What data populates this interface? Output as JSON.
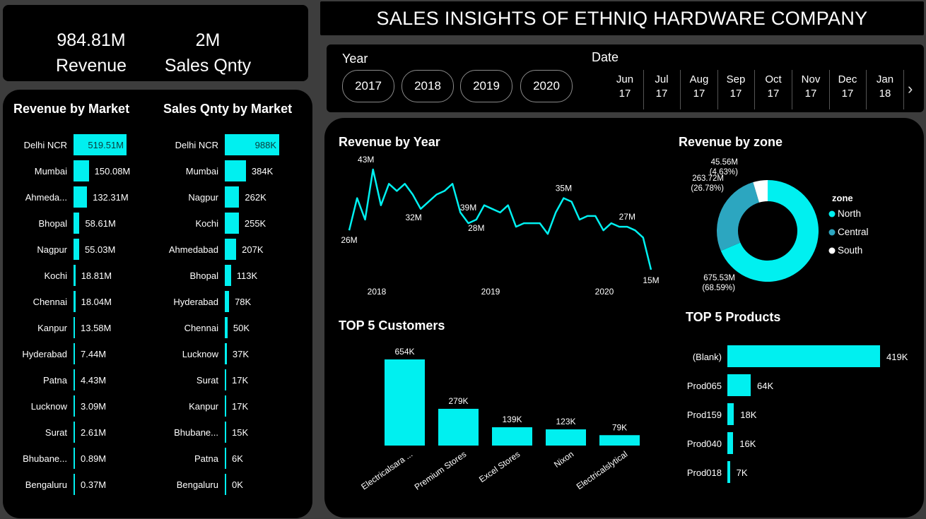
{
  "kpis": {
    "revenue_value": "984.81M",
    "revenue_label": "Revenue",
    "qty_value": "2M",
    "qty_label": "Sales Qnty"
  },
  "title": "SALES INSIGHTS OF ETHNIQ HARDWARE  COMPANY",
  "filters": {
    "year_label": "Year",
    "years": [
      "2017",
      "2018",
      "2019",
      "2020"
    ],
    "date_label": "Date",
    "dates": [
      {
        "m": "Jun",
        "y": "17"
      },
      {
        "m": "Jul",
        "y": "17"
      },
      {
        "m": "Aug",
        "y": "17"
      },
      {
        "m": "Sep",
        "y": "17"
      },
      {
        "m": "Oct",
        "y": "17"
      },
      {
        "m": "Nov",
        "y": "17"
      },
      {
        "m": "Dec",
        "y": "17"
      },
      {
        "m": "Jan",
        "y": "18"
      }
    ],
    "next_icon": "chevron-right-icon"
  },
  "colors": {
    "accent": "#00f0f0",
    "central": "#2ca6c0",
    "south": "#ffffff",
    "panel": "#000000",
    "background": "#3d3d3d"
  },
  "chart_data": [
    {
      "type": "bar",
      "orientation": "horizontal",
      "title": "Revenue by Market",
      "categories": [
        "Delhi NCR",
        "Mumbai",
        "Ahmeda...",
        "Bhopal",
        "Nagpur",
        "Kochi",
        "Chennai",
        "Kanpur",
        "Hyderabad",
        "Patna",
        "Lucknow",
        "Surat",
        "Bhubane...",
        "Bengaluru"
      ],
      "values": [
        519.51,
        150.08,
        132.31,
        58.61,
        55.03,
        18.81,
        18.04,
        13.58,
        7.44,
        4.43,
        3.09,
        2.61,
        0.89,
        0.37
      ],
      "labels": [
        "519.51M",
        "150.08M",
        "132.31M",
        "58.61M",
        "55.03M",
        "18.81M",
        "18.04M",
        "13.58M",
        "7.44M",
        "4.43M",
        "3.09M",
        "2.61M",
        "0.89M",
        "0.37M"
      ]
    },
    {
      "type": "bar",
      "orientation": "horizontal",
      "title": "Sales Qnty by Market",
      "categories": [
        "Delhi NCR",
        "Mumbai",
        "Nagpur",
        "Kochi",
        "Ahmedabad",
        "Bhopal",
        "Hyderabad",
        "Chennai",
        "Lucknow",
        "Surat",
        "Kanpur",
        "Bhubane...",
        "Patna",
        "Bengaluru"
      ],
      "values": [
        988,
        384,
        262,
        255,
        207,
        113,
        78,
        50,
        37,
        17,
        17,
        15,
        6,
        0
      ],
      "labels": [
        "988K",
        "384K",
        "262K",
        "255K",
        "207K",
        "113K",
        "78K",
        "50K",
        "37K",
        "17K",
        "17K",
        "15K",
        "6K",
        "0K"
      ]
    },
    {
      "type": "line",
      "title": "Revenue by Year",
      "x_ticks": [
        "2018",
        "2019",
        "2020"
      ],
      "values": [
        26,
        35,
        29,
        43,
        33,
        39,
        37,
        39,
        36,
        32,
        34,
        36,
        37,
        39,
        31,
        28,
        29,
        33,
        32,
        31,
        33,
        27,
        28,
        28,
        28,
        25,
        31,
        35,
        34,
        29,
        30,
        30,
        26,
        28,
        27,
        27,
        26,
        24,
        15
      ],
      "annotations": [
        "26M",
        "43M",
        "32M",
        "39M",
        "28M",
        "35M",
        "27M",
        "15M"
      ]
    },
    {
      "type": "pie",
      "title": "Revenue by zone",
      "legend_title": "zone",
      "legend": "right",
      "slices": [
        {
          "name": "North",
          "value": 675.53,
          "label": "675.53M",
          "pct": "(68.59%)"
        },
        {
          "name": "Central",
          "value": 263.72,
          "label": "263.72M",
          "pct": "(26.78%)"
        },
        {
          "name": "South",
          "value": 45.56,
          "label": "45.56M",
          "pct": "(4.63%)"
        }
      ]
    },
    {
      "type": "bar",
      "title": "TOP 5 Customers",
      "categories": [
        "Electricalsara ...",
        "Premium Stores",
        "Excel Stores",
        "Nixon",
        "Electricalslytical"
      ],
      "values": [
        654,
        279,
        139,
        123,
        79
      ],
      "labels": [
        "654K",
        "279K",
        "139K",
        "123K",
        "79K"
      ]
    },
    {
      "type": "bar",
      "orientation": "horizontal",
      "title": "TOP 5 Products",
      "categories": [
        "(Blank)",
        "Prod065",
        "Prod159",
        "Prod040",
        "Prod018"
      ],
      "values": [
        419,
        64,
        18,
        16,
        7
      ],
      "labels": [
        "419K",
        "64K",
        "18K",
        "16K",
        "7K"
      ]
    }
  ]
}
